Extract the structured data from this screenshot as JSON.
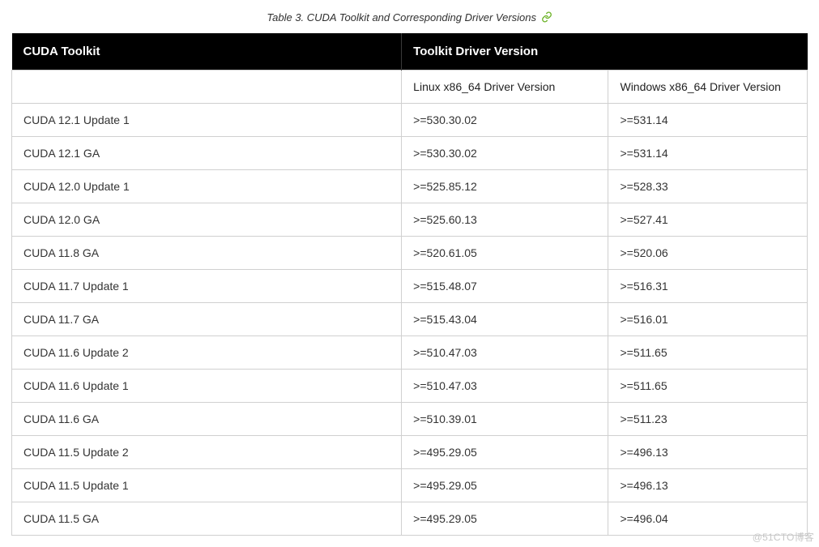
{
  "caption": "Table 3. CUDA Toolkit and Corresponding Driver Versions",
  "link_icon_label": "permalink",
  "header": {
    "col_toolkit": "CUDA Toolkit",
    "col_driver_group": "Toolkit Driver Version"
  },
  "subheader": {
    "col_toolkit": "",
    "col_linux": "Linux x86_64 Driver Version",
    "col_windows": "Windows x86_64 Driver Version"
  },
  "chart_data": {
    "type": "table",
    "rows": [
      {
        "toolkit": "CUDA 12.1 Update 1",
        "linux": ">=530.30.02",
        "windows": ">=531.14"
      },
      {
        "toolkit": "CUDA 12.1 GA",
        "linux": ">=530.30.02",
        "windows": ">=531.14"
      },
      {
        "toolkit": "CUDA 12.0 Update 1",
        "linux": ">=525.85.12",
        "windows": ">=528.33"
      },
      {
        "toolkit": "CUDA 12.0 GA",
        "linux": ">=525.60.13",
        "windows": ">=527.41"
      },
      {
        "toolkit": "CUDA 11.8 GA",
        "linux": ">=520.61.05",
        "windows": ">=520.06"
      },
      {
        "toolkit": "CUDA 11.7 Update 1",
        "linux": ">=515.48.07",
        "windows": ">=516.31"
      },
      {
        "toolkit": "CUDA 11.7 GA",
        "linux": ">=515.43.04",
        "windows": ">=516.01"
      },
      {
        "toolkit": "CUDA 11.6 Update 2",
        "linux": ">=510.47.03",
        "windows": ">=511.65"
      },
      {
        "toolkit": "CUDA 11.6 Update 1",
        "linux": ">=510.47.03",
        "windows": ">=511.65"
      },
      {
        "toolkit": "CUDA 11.6 GA",
        "linux": ">=510.39.01",
        "windows": ">=511.23"
      },
      {
        "toolkit": "CUDA 11.5 Update 2",
        "linux": ">=495.29.05",
        "windows": ">=496.13"
      },
      {
        "toolkit": "CUDA 11.5 Update 1",
        "linux": ">=495.29.05",
        "windows": ">=496.13"
      },
      {
        "toolkit": "CUDA 11.5 GA",
        "linux": ">=495.29.05",
        "windows": ">=496.04"
      }
    ]
  },
  "watermark": "@51CTO博客"
}
